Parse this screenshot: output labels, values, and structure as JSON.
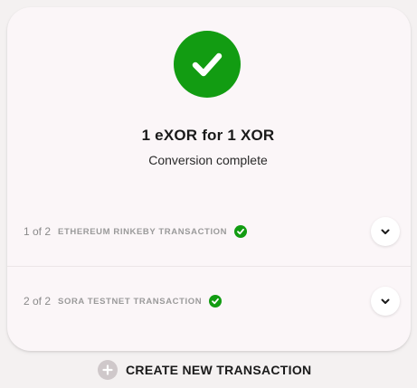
{
  "summary": {
    "title": "1 eXOR for 1 XOR",
    "subtitle": "Conversion complete"
  },
  "transactions": [
    {
      "step": "1 of 2",
      "label": "ETHEREUM RINKEBY TRANSACTION",
      "status_icon": "check-circle-icon",
      "expand_icon": "chevron-down-icon"
    },
    {
      "step": "2 of 2",
      "label": "SORA TESTNET TRANSACTION",
      "status_icon": "check-circle-icon",
      "expand_icon": "chevron-down-icon"
    }
  ],
  "actions": {
    "create_new_label": "CREATE NEW TRANSACTION",
    "create_new_icon": "plus-circle-icon"
  },
  "colors": {
    "success": "#129c12",
    "card_background": "#fbf6f8",
    "page_background": "#f4f1f1",
    "plus_icon_background": "#cfc8ca"
  }
}
